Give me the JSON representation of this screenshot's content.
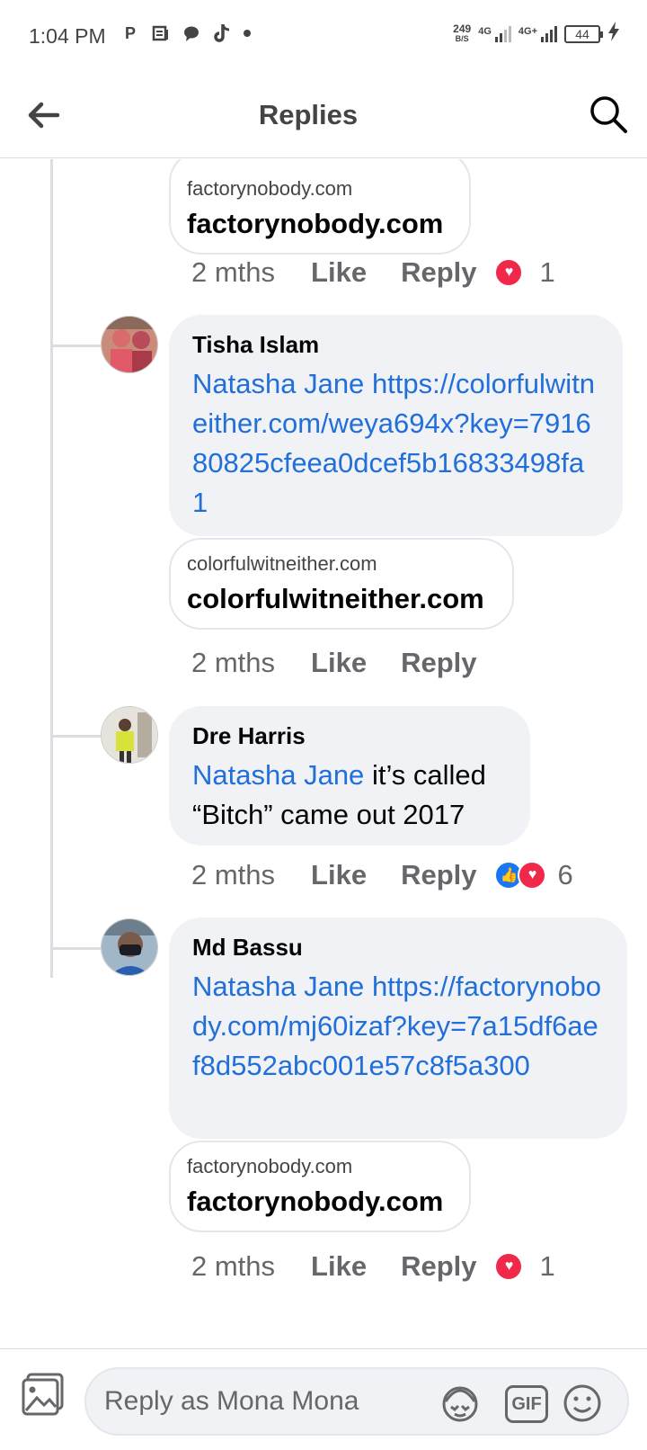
{
  "status_bar": {
    "time": "1:04 PM",
    "net_speed_value": "249",
    "net_speed_unit": "B/S",
    "network1": "4G",
    "network2": "4G+",
    "battery": "44"
  },
  "header": {
    "title": "Replies"
  },
  "comments": [
    {
      "preview": {
        "domain": "factorynobody.com",
        "title": "factorynobody.com"
      },
      "time": "2 mths",
      "like_label": "Like",
      "reply_label": "Reply",
      "reaction_count": "1"
    },
    {
      "author": "Tisha Islam",
      "mention": "Natasha Jane",
      "text": "https://colorfulwitneither.com/weya694x?key=791680825cfeea0dcef5b16833498fa1",
      "preview": {
        "domain": "colorfulwitneither.com",
        "title": "colorfulwitneither.com"
      },
      "time": "2 mths",
      "like_label": "Like",
      "reply_label": "Reply"
    },
    {
      "author": "Dre Harris",
      "mention": "Natasha Jane",
      "text": "it’s called “Bitch” came out 2017",
      "time": "2 mths",
      "like_label": "Like",
      "reply_label": "Reply",
      "reaction_count": "6"
    },
    {
      "author": "Md Bassu",
      "mention": "Natasha Jane",
      "text": "https://factorynobody.com/mj60izaf?key=7a15df6aef8d552abc001e57c8f5a300",
      "preview": {
        "domain": "factorynobody.com",
        "title": "factorynobody.com"
      },
      "time": "2 mths",
      "like_label": "Like",
      "reply_label": "Reply",
      "reaction_count": "1"
    }
  ],
  "composer": {
    "placeholder": "Reply as Mona Mona",
    "gif_label": "GIF"
  },
  "colors": {
    "link": "#216fdb",
    "bubble": "#f0f2f5",
    "love": "#f02849",
    "like": "#1877f2"
  }
}
